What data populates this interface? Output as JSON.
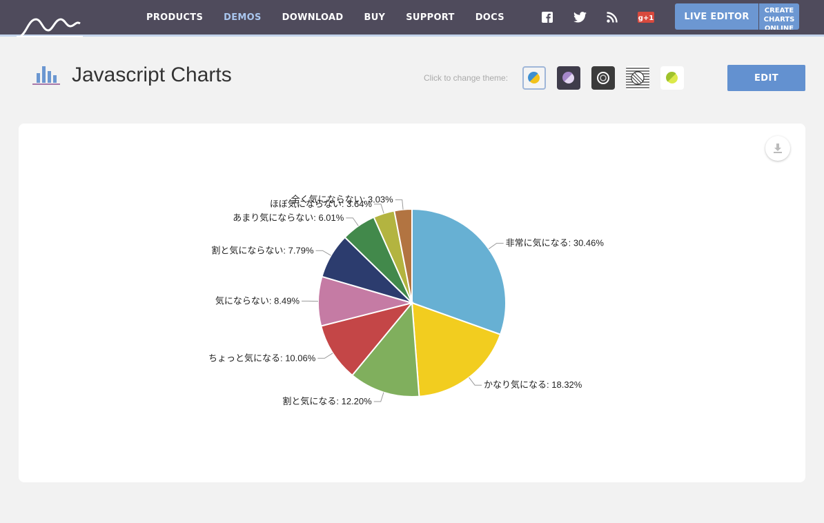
{
  "nav": {
    "links": [
      {
        "label": "PRODUCTS",
        "active": false
      },
      {
        "label": "DEMOS",
        "active": true
      },
      {
        "label": "DOWNLOAD",
        "active": false
      },
      {
        "label": "BUY",
        "active": false
      },
      {
        "label": "SUPPORT",
        "active": false
      },
      {
        "label": "DOCS",
        "active": false
      }
    ],
    "social_icons": [
      "facebook-icon",
      "twitter-icon",
      "rss-icon",
      "google-plus-icon"
    ],
    "google_plus_text": "g+1",
    "live_editor_label": "LIVE EDITOR",
    "create_charts_lines": [
      "CREATE",
      "CHARTS",
      "ONLINE"
    ]
  },
  "header": {
    "title": "Javascript Charts",
    "theme_label": "Click to change theme:",
    "themes": [
      "light",
      "dark",
      "chalk",
      "patterns",
      "default"
    ],
    "edit_label": "EDIT"
  },
  "colors": {
    "nav_bg": "#4f4b5c",
    "accent": "#6391d0"
  },
  "chart_data": {
    "type": "pie",
    "start_angle_deg": 0,
    "slices": [
      {
        "label": "非常に気になる",
        "value": 30.46,
        "percent_text": "30.46%",
        "color": "#67b0d3"
      },
      {
        "label": "かなり気になる",
        "value": 18.32,
        "percent_text": "18.32%",
        "color": "#f2cd1f"
      },
      {
        "label": "割と気になる",
        "value": 12.2,
        "percent_text": "12.20%",
        "color": "#80af5d"
      },
      {
        "label": "ちょっと気になる",
        "value": 10.06,
        "percent_text": "10.06%",
        "color": "#c44647"
      },
      {
        "label": "気にならない",
        "value": 8.49,
        "percent_text": "8.49%",
        "color": "#c57ba4"
      },
      {
        "label": "割と気にならない",
        "value": 7.79,
        "percent_text": "7.79%",
        "color": "#2c3c6e"
      },
      {
        "label": "あまり気にならない",
        "value": 6.01,
        "percent_text": "6.01%",
        "color": "#42894b"
      },
      {
        "label": "ほぼ気にならない",
        "value": 3.64,
        "percent_text": "3.64%",
        "color": "#b3b440"
      },
      {
        "label": "全く気にならない",
        "value": 3.03,
        "percent_text": "3.03%",
        "color": "#b27441"
      }
    ]
  }
}
